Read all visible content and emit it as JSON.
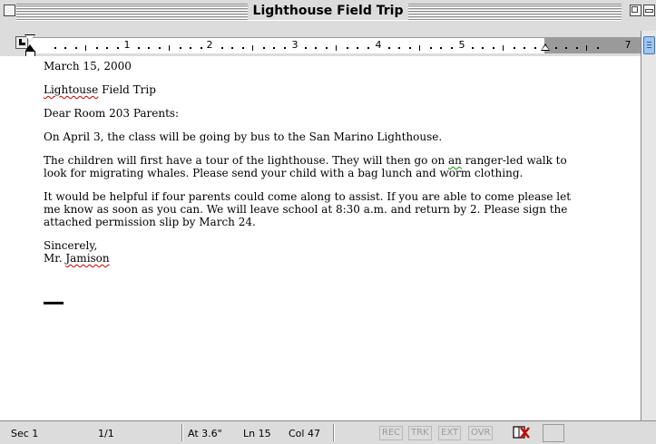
{
  "window": {
    "title": "Lighthouse Field Trip"
  },
  "ruler": {
    "numbers": [
      "1",
      "2",
      "3",
      "4",
      "5",
      "7"
    ]
  },
  "document": {
    "date": "March 15, 2000",
    "subject_word1": "Lightouse",
    "subject_rest": " Field Trip",
    "greeting": "Dear Room 203 Parents:",
    "para1": "On April 3, the class will be going by bus to the San Marino Lighthouse.",
    "para2_before": "The children will first have a tour of the lighthouse. They will then go on ",
    "para2_flag": "an",
    "para2_after": " ranger-led walk to look for migrating whales. Please send your child with a bag lunch and worm clothing.",
    "para3": "It would be helpful if four parents could come along to assist. If you are able to come please let me know as soon as you can. We will leave school at 8:30 a.m. and return by 2. Please sign the attached permission slip by March 24.",
    "closing": "Sincerely,",
    "signature_prefix": "Mr. ",
    "signature_name": "Jamison"
  },
  "statusbar": {
    "section": "Sec 1",
    "page": "1/1",
    "at": "At 3.6\"",
    "line": "Ln 15",
    "col": "Col 47",
    "rec": "REC",
    "trk": "TRK",
    "ext": "EXT",
    "ovr": "OVR"
  },
  "colors": {
    "spelling_error": "#c80000",
    "grammar_error": "#00a000",
    "scroll_thumb": "#9fc6ee"
  }
}
